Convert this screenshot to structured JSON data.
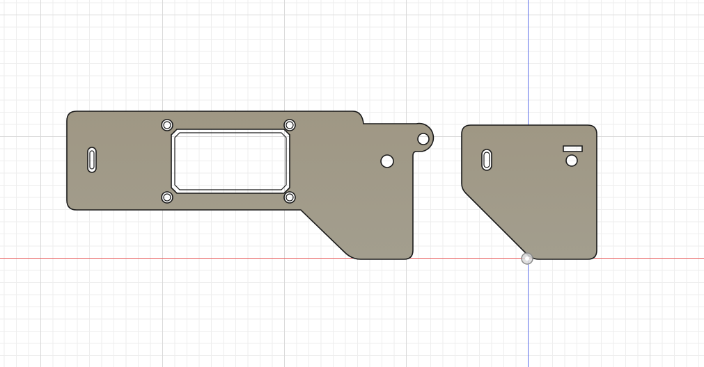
{
  "viewport": {
    "background": "#ffffff",
    "grid_minor_color": "#eeeeee",
    "grid_major_color": "#d9d9d9",
    "x_axis_color": "#e85b5b",
    "y_axis_color": "#5b6ee8"
  },
  "parts": {
    "fill_color": "#a19a88",
    "edge_color": "#1a1a1a",
    "hole_fill": "#ffffff"
  },
  "icons": {
    "origin": "origin-point-icon"
  }
}
